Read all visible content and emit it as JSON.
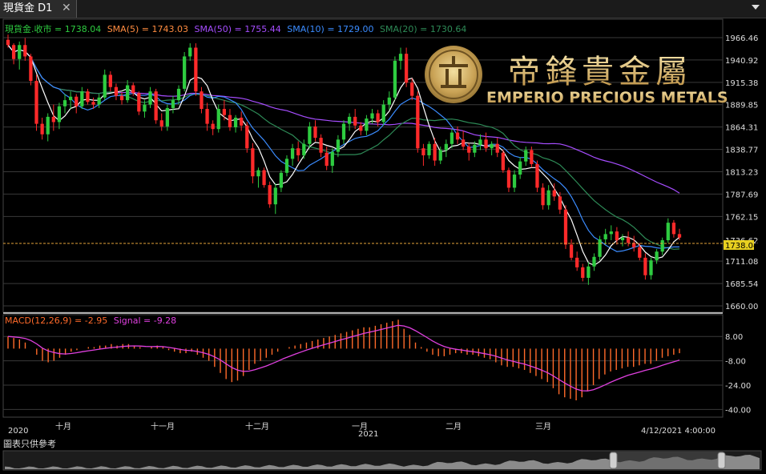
{
  "tab": {
    "title": "現貨金 D1",
    "close": "✕"
  },
  "legend": {
    "main": [
      {
        "text": "現貨金.收市 = 1738.04",
        "color": "#2ecc40"
      },
      {
        "text": "SMA(5) = 1743.03",
        "color": "#ff8c40"
      },
      {
        "text": "SMA(50) = 1755.44",
        "color": "#a64dff"
      },
      {
        "text": "SMA(10) = 1729.00",
        "color": "#3b8cff"
      },
      {
        "text": "SMA(20) = 1730.64",
        "color": "#2e8b57"
      }
    ],
    "macd": [
      {
        "text": "MACD(12,26,9) = -2.95",
        "color": "#ff6a2a"
      },
      {
        "text": "Signal = -9.28",
        "color": "#e040e0"
      }
    ]
  },
  "logo": {
    "chinese": "帝鋒貴金屬",
    "english": "EMPERIO PRECIOUS METALS"
  },
  "price_axis": {
    "ticks": [
      "1966.46",
      "1940.92",
      "1915.38",
      "1889.85",
      "1864.31",
      "1838.77",
      "1813.23",
      "1787.69",
      "1762.15",
      "1711.08",
      "1685.54",
      "1660.00"
    ],
    "marker_lo": "1738.04",
    "marker_hi": "1736.62"
  },
  "macd_axis": {
    "ticks": [
      "8.00",
      "-8.00",
      "-24.00",
      "-40.00"
    ]
  },
  "time_axis": {
    "labels": [
      "十月",
      "十一月",
      "十二月",
      "一月",
      "二月",
      "三月"
    ],
    "years": [
      "2020",
      "2021"
    ],
    "cursor_time": "4/12/2021 4:00:00"
  },
  "disclaimer": "圖表只供參考",
  "chart_data": [
    {
      "type": "candlestick",
      "title": "現貨金 D1",
      "yrange": [
        1660.0,
        1966.46
      ],
      "last_close": 1738.04,
      "grid": true,
      "candles": [
        [
          1964,
          1970,
          1955,
          1958
        ],
        [
          1958,
          1960,
          1936,
          1942
        ],
        [
          1942,
          1962,
          1930,
          1958
        ],
        [
          1958,
          1966,
          1940,
          1945
        ],
        [
          1945,
          1948,
          1912,
          1917
        ],
        [
          1917,
          1924,
          1860,
          1868
        ],
        [
          1868,
          1875,
          1850,
          1856
        ],
        [
          1856,
          1880,
          1848,
          1876
        ],
        [
          1876,
          1890,
          1860,
          1870
        ],
        [
          1870,
          1892,
          1862,
          1888
        ],
        [
          1888,
          1902,
          1880,
          1895
        ],
        [
          1895,
          1905,
          1885,
          1899
        ],
        [
          1899,
          1902,
          1880,
          1888
        ],
        [
          1888,
          1910,
          1885,
          1905
        ],
        [
          1905,
          1908,
          1890,
          1893
        ],
        [
          1893,
          1898,
          1885,
          1890
        ],
        [
          1890,
          1902,
          1886,
          1898
        ],
        [
          1898,
          1930,
          1895,
          1924
        ],
        [
          1924,
          1928,
          1905,
          1910
        ],
        [
          1910,
          1914,
          1895,
          1900
        ],
        [
          1900,
          1904,
          1890,
          1895
        ],
        [
          1895,
          1918,
          1892,
          1912
        ],
        [
          1912,
          1915,
          1900,
          1903
        ],
        [
          1903,
          1905,
          1878,
          1882
        ],
        [
          1882,
          1895,
          1875,
          1890
        ],
        [
          1890,
          1910,
          1886,
          1905
        ],
        [
          1905,
          1908,
          1868,
          1872
        ],
        [
          1872,
          1880,
          1860,
          1865
        ],
        [
          1865,
          1890,
          1860,
          1886
        ],
        [
          1886,
          1900,
          1880,
          1895
        ],
        [
          1895,
          1912,
          1890,
          1908
        ],
        [
          1908,
          1950,
          1905,
          1945
        ],
        [
          1945,
          1960,
          1940,
          1955
        ],
        [
          1955,
          1960,
          1900,
          1905
        ],
        [
          1905,
          1910,
          1880,
          1885
        ],
        [
          1885,
          1892,
          1860,
          1868
        ],
        [
          1868,
          1872,
          1855,
          1862
        ],
        [
          1862,
          1890,
          1858,
          1885
        ],
        [
          1885,
          1895,
          1872,
          1878
        ],
        [
          1878,
          1885,
          1860,
          1864
        ],
        [
          1864,
          1878,
          1858,
          1875
        ],
        [
          1875,
          1882,
          1860,
          1866
        ],
        [
          1866,
          1870,
          1835,
          1840
        ],
        [
          1840,
          1846,
          1800,
          1808
        ],
        [
          1808,
          1818,
          1795,
          1815
        ],
        [
          1815,
          1818,
          1795,
          1798
        ],
        [
          1798,
          1802,
          1772,
          1776
        ],
        [
          1776,
          1800,
          1765,
          1795
        ],
        [
          1795,
          1815,
          1790,
          1812
        ],
        [
          1812,
          1832,
          1808,
          1828
        ],
        [
          1828,
          1845,
          1820,
          1840
        ],
        [
          1840,
          1848,
          1825,
          1832
        ],
        [
          1832,
          1850,
          1828,
          1845
        ],
        [
          1845,
          1870,
          1840,
          1865
        ],
        [
          1865,
          1872,
          1848,
          1852
        ],
        [
          1852,
          1856,
          1830,
          1835
        ],
        [
          1835,
          1842,
          1815,
          1820
        ],
        [
          1820,
          1840,
          1812,
          1836
        ],
        [
          1836,
          1855,
          1830,
          1850
        ],
        [
          1850,
          1872,
          1845,
          1868
        ],
        [
          1868,
          1880,
          1860,
          1876
        ],
        [
          1876,
          1885,
          1862,
          1866
        ],
        [
          1866,
          1870,
          1855,
          1860
        ],
        [
          1860,
          1878,
          1855,
          1874
        ],
        [
          1874,
          1885,
          1868,
          1880
        ],
        [
          1880,
          1884,
          1865,
          1870
        ],
        [
          1870,
          1895,
          1866,
          1890
        ],
        [
          1890,
          1905,
          1884,
          1898
        ],
        [
          1898,
          1945,
          1895,
          1940
        ],
        [
          1940,
          1955,
          1930,
          1948
        ],
        [
          1948,
          1955,
          1910,
          1915
        ],
        [
          1915,
          1920,
          1895,
          1900
        ],
        [
          1900,
          1905,
          1835,
          1840
        ],
        [
          1840,
          1845,
          1820,
          1832
        ],
        [
          1832,
          1848,
          1828,
          1845
        ],
        [
          1845,
          1852,
          1820,
          1826
        ],
        [
          1826,
          1842,
          1822,
          1838
        ],
        [
          1838,
          1850,
          1830,
          1845
        ],
        [
          1845,
          1862,
          1840,
          1858
        ],
        [
          1858,
          1865,
          1845,
          1850
        ],
        [
          1850,
          1860,
          1838,
          1842
        ],
        [
          1842,
          1846,
          1826,
          1835
        ],
        [
          1835,
          1848,
          1830,
          1844
        ],
        [
          1844,
          1856,
          1838,
          1850
        ],
        [
          1850,
          1858,
          1836,
          1840
        ],
        [
          1840,
          1848,
          1832,
          1845
        ],
        [
          1845,
          1852,
          1830,
          1835
        ],
        [
          1835,
          1838,
          1812,
          1815
        ],
        [
          1815,
          1818,
          1790,
          1795
        ],
        [
          1795,
          1815,
          1790,
          1810
        ],
        [
          1810,
          1830,
          1805,
          1825
        ],
        [
          1825,
          1842,
          1820,
          1838
        ],
        [
          1838,
          1842,
          1818,
          1822
        ],
        [
          1822,
          1826,
          1790,
          1795
        ],
        [
          1795,
          1800,
          1770,
          1775
        ],
        [
          1775,
          1798,
          1770,
          1792
        ],
        [
          1792,
          1800,
          1780,
          1785
        ],
        [
          1785,
          1790,
          1765,
          1770
        ],
        [
          1770,
          1775,
          1725,
          1730
        ],
        [
          1730,
          1736,
          1712,
          1715
        ],
        [
          1715,
          1722,
          1700,
          1704
        ],
        [
          1704,
          1708,
          1688,
          1692
        ],
        [
          1692,
          1710,
          1684,
          1705
        ],
        [
          1705,
          1720,
          1700,
          1716
        ],
        [
          1716,
          1740,
          1712,
          1736
        ],
        [
          1736,
          1748,
          1730,
          1742
        ],
        [
          1742,
          1752,
          1735,
          1745
        ],
        [
          1745,
          1750,
          1730,
          1735
        ],
        [
          1735,
          1742,
          1728,
          1738
        ],
        [
          1738,
          1745,
          1728,
          1732
        ],
        [
          1732,
          1740,
          1722,
          1727
        ],
        [
          1727,
          1732,
          1712,
          1715
        ],
        [
          1715,
          1720,
          1690,
          1695
        ],
        [
          1695,
          1715,
          1690,
          1712
        ],
        [
          1712,
          1725,
          1708,
          1722
        ],
        [
          1722,
          1738,
          1718,
          1735
        ],
        [
          1735,
          1760,
          1732,
          1755
        ],
        [
          1755,
          1758,
          1738,
          1742
        ],
        [
          1742,
          1748,
          1735,
          1738
        ]
      ],
      "series": [
        {
          "name": "SMA(5)",
          "color": "#ffffff",
          "last": 1743.03
        },
        {
          "name": "SMA(10)",
          "color": "#3b8cff",
          "last": 1729.0
        },
        {
          "name": "SMA(20)",
          "color": "#2e8b57",
          "last": 1730.64
        },
        {
          "name": "SMA(50)",
          "color": "#a64dff",
          "last": 1755.44
        }
      ]
    },
    {
      "type": "bar",
      "title": "MACD(12,26,9)",
      "yrange": [
        -44,
        16
      ],
      "macd_last": -2.95,
      "signal_last": -9.28,
      "histogram": [
        8,
        7,
        6,
        4,
        0,
        -4,
        -8,
        -9,
        -8,
        -6,
        -4,
        -2,
        -1,
        0,
        1,
        1,
        2,
        2,
        3,
        2,
        3,
        3,
        2,
        1,
        0,
        1,
        2,
        1,
        -1,
        -2,
        -3,
        -3,
        -2,
        -4,
        -6,
        -8,
        -12,
        -16,
        -20,
        -22,
        -21,
        -18,
        -14,
        -10,
        -8,
        -6,
        -4,
        -2,
        0,
        1,
        2,
        3,
        4,
        5,
        6,
        7,
        8,
        9,
        10,
        11,
        12,
        13,
        14,
        14,
        15,
        16,
        17,
        18,
        19,
        13,
        9,
        4,
        1,
        -2,
        -4,
        -5,
        -5,
        -4,
        -3,
        -3,
        -4,
        -4,
        -5,
        -6,
        -7,
        -9,
        -11,
        -12,
        -12,
        -13,
        -14,
        -16,
        -18,
        -20,
        -22,
        -26,
        -30,
        -32,
        -33,
        -34,
        -32,
        -28,
        -24,
        -20,
        -17,
        -15,
        -14,
        -13,
        -12,
        -12,
        -11,
        -10,
        -10,
        -8,
        -6,
        -5,
        -4,
        -3
      ],
      "signal": [
        8,
        7.7,
        7.3,
        6.7,
        5.3,
        3.1,
        0.3,
        -1.5,
        -2.6,
        -3.3,
        -3.5,
        -3.2,
        -2.7,
        -2.0,
        -1.4,
        -0.9,
        -0.3,
        0.2,
        0.7,
        1.0,
        1.4,
        1.7,
        1.8,
        1.7,
        1.4,
        1.3,
        1.4,
        1.3,
        0.8,
        0.2,
        -0.5,
        -1.1,
        -1.3,
        -1.9,
        -2.7,
        -3.8,
        -5.4,
        -7.5,
        -10.0,
        -12.4,
        -14.1,
        -15.0,
        -14.8,
        -13.9,
        -12.7,
        -11.4,
        -9.9,
        -8.3,
        -6.6,
        -5.1,
        -3.7,
        -2.3,
        -1.0,
        0.2,
        1.4,
        2.5,
        3.6,
        4.7,
        5.8,
        6.8,
        7.9,
        8.9,
        10.0,
        10.8,
        11.7,
        12.6,
        13.5,
        14.4,
        15.3,
        14.9,
        13.7,
        11.8,
        9.6,
        7.3,
        5.0,
        3.0,
        1.4,
        0.3,
        -0.4,
        -0.9,
        -1.5,
        -2.0,
        -2.6,
        -3.3,
        -4.0,
        -5.0,
        -6.2,
        -7.4,
        -8.3,
        -9.3,
        -10.2,
        -11.4,
        -12.7,
        -14.2,
        -15.8,
        -17.9,
        -20.3,
        -22.6,
        -24.7,
        -26.6,
        -27.7,
        -27.8,
        -27.0,
        -25.6,
        -23.9,
        -22.1,
        -20.5,
        -19.0,
        -17.6,
        -16.5,
        -15.4,
        -14.3,
        -13.4,
        -12.3,
        -11.0,
        -9.8,
        -8.7,
        -7.6
      ]
    }
  ]
}
